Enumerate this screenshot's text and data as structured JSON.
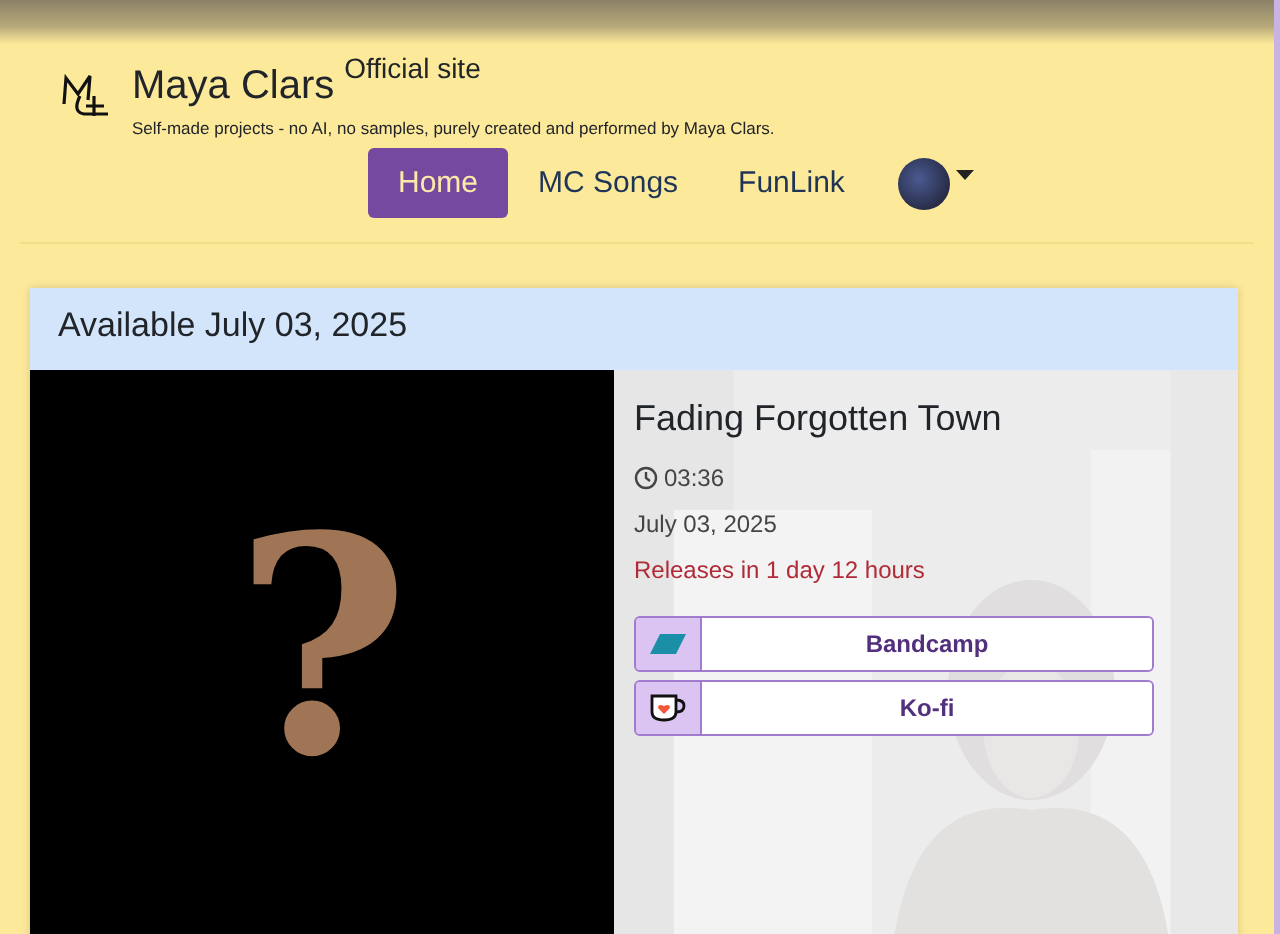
{
  "site": {
    "name": "Maya Clars",
    "tag": "Official site",
    "subtitle": "Self-made projects - no AI, no samples, purely created and performed by Maya Clars."
  },
  "nav": [
    {
      "label": "Home",
      "selected": true
    },
    {
      "label": "MC Songs",
      "selected": false
    },
    {
      "label": "FunLink",
      "selected": false
    }
  ],
  "release": {
    "heading": "Available July 03, 2025",
    "cover": "?",
    "title": "Fading Forgotten Town",
    "duration": "03:36",
    "date": "July 03, 2025",
    "countdown": "Releases in 1 day 12 hours",
    "links": [
      {
        "kind": "bandcamp",
        "label": "Bandcamp"
      },
      {
        "kind": "kofi",
        "label": "Ko-fi"
      }
    ]
  }
}
